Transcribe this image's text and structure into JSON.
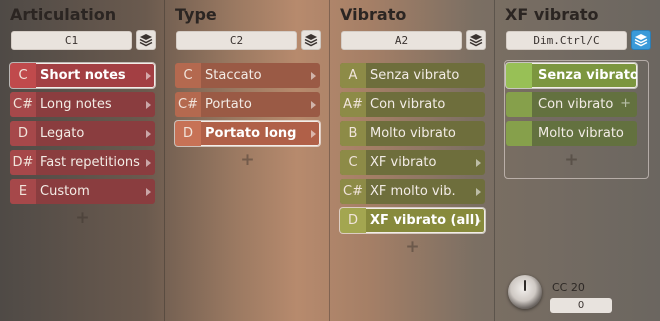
{
  "columns": [
    {
      "title": "Articulation",
      "selector": "C1",
      "layers_active": false,
      "items": [
        {
          "key": "C",
          "label": "Short notes",
          "selected": true
        },
        {
          "key": "C#",
          "label": "Long notes"
        },
        {
          "key": "D",
          "label": "Legato"
        },
        {
          "key": "D#",
          "label": "Fast repetitions"
        },
        {
          "key": "E",
          "label": "Custom"
        }
      ],
      "add_label": "+"
    },
    {
      "title": "Type",
      "selector": "C2",
      "layers_active": false,
      "items": [
        {
          "key": "C",
          "label": "Staccato"
        },
        {
          "key": "C#",
          "label": "Portato"
        },
        {
          "key": "D",
          "label": "Portato long",
          "selected": true
        }
      ],
      "add_label": "+"
    },
    {
      "title": "Vibrato",
      "selector": "A2",
      "layers_active": false,
      "items": [
        {
          "key": "A",
          "label": "Senza vibrato"
        },
        {
          "key": "A#",
          "label": "Con vibrato"
        },
        {
          "key": "B",
          "label": "Molto vibrato"
        },
        {
          "key": "C",
          "label": "XF vibrato"
        },
        {
          "key": "C#",
          "label": "XF molto vib."
        },
        {
          "key": "D",
          "label": "XF vibrato (all)",
          "selected": true
        }
      ],
      "add_label": "+"
    },
    {
      "title": "XF vibrato",
      "selector": "Dim.Ctrl/C",
      "layers_active": true,
      "items": [
        {
          "key": "",
          "label": "Senza vibrato",
          "selected": true
        },
        {
          "key": "",
          "label": "Con vibrato",
          "extra": "+"
        },
        {
          "key": "",
          "label": "Molto vibrato"
        }
      ],
      "add_label": "+"
    }
  ],
  "cc": {
    "label": "CC 20",
    "value": "0"
  },
  "icons": {
    "layers": "layers-icon",
    "arrow": "chevron-right-icon",
    "knob": "knob-icon"
  },
  "colors": {
    "articulation": "#8a3d3f",
    "type": "#9a5a45",
    "vibrato": "#6e6e3c",
    "xf_vibrato": "#63713f",
    "layers_active": "#3a9ad9"
  }
}
